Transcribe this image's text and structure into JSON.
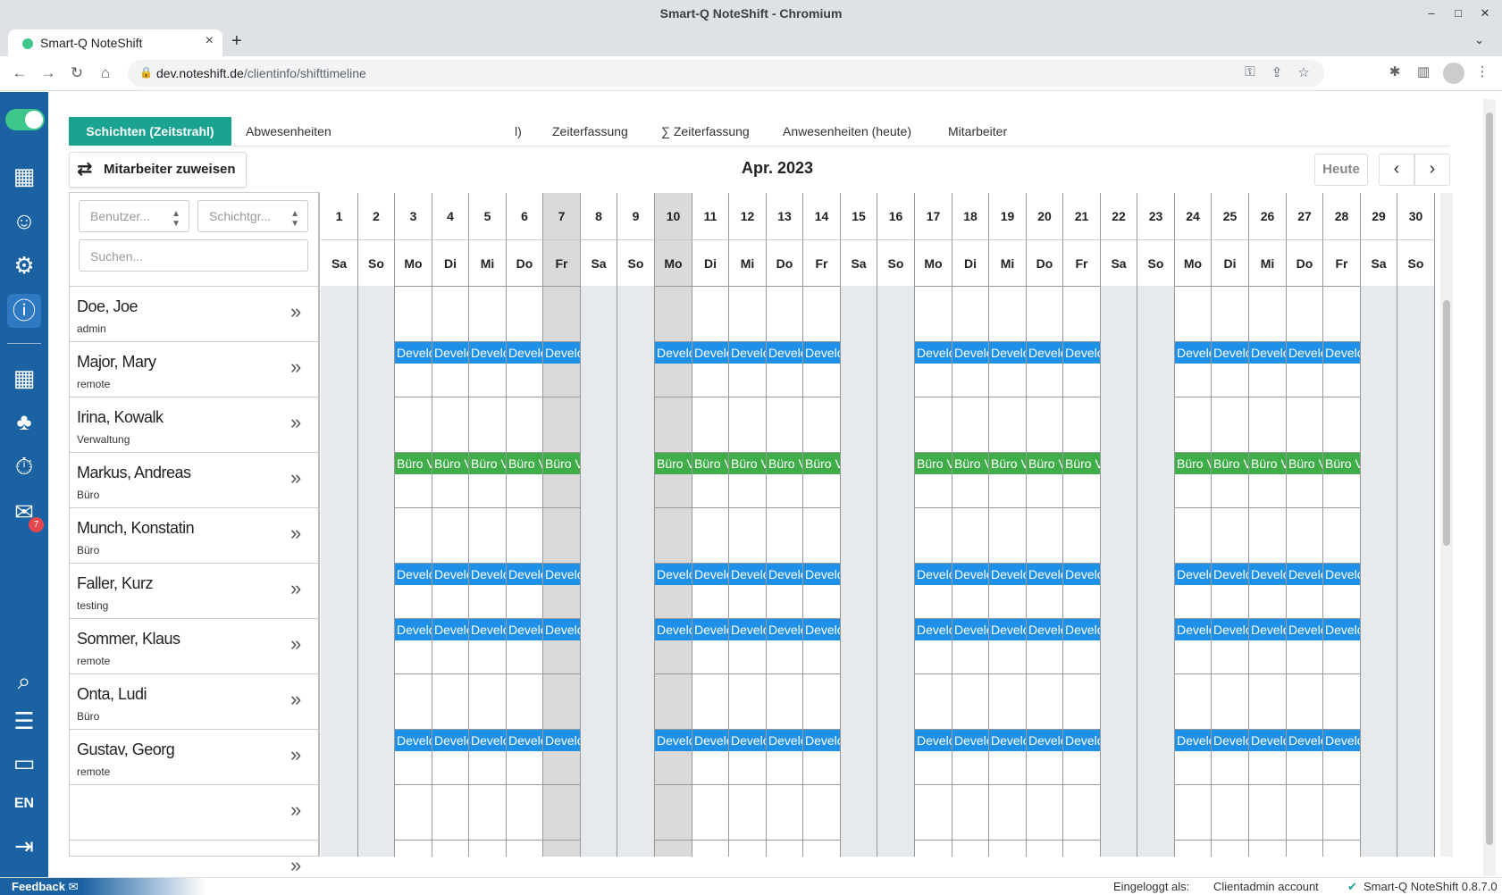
{
  "window": {
    "title": "Smart-Q NoteShift - Chromium"
  },
  "browser": {
    "tab_title": "Smart-Q NoteShift",
    "url_host": "dev.noteshift.de",
    "url_path": "/clientinfo/shifttimeline"
  },
  "tabs": {
    "active": "Schichten (Zeitstrahl)",
    "items": [
      "Abwesenheiten",
      "l)",
      "Zeiterfassung",
      "∑ Zeiterfassung",
      "Anwesenheiten (heute)",
      "Mitarbeiter"
    ]
  },
  "toolbar": {
    "assign_label": "Mitarbeiter zuweisen",
    "month_label": "Apr. 2023",
    "today_label": "Heute"
  },
  "filters": {
    "user_placeholder": "Benutzer...",
    "group_placeholder": "Schichtgr...",
    "search_placeholder": "Suchen..."
  },
  "sidebar": {
    "mail_badge": "7"
  },
  "days": [
    "1",
    "2",
    "3",
    "4",
    "5",
    "6",
    "7",
    "8",
    "9",
    "10",
    "11",
    "12",
    "13",
    "14",
    "15",
    "16",
    "17",
    "18",
    "19",
    "20",
    "21",
    "22",
    "23",
    "24",
    "25",
    "26",
    "27",
    "28",
    "29",
    "30"
  ],
  "weekdays": [
    "Sa",
    "So",
    "Mo",
    "Di",
    "Mi",
    "Do",
    "Fr",
    "Sa",
    "So",
    "Mo",
    "Di",
    "Mi",
    "Do",
    "Fr",
    "Sa",
    "So",
    "Mo",
    "Di",
    "Mi",
    "Do",
    "Fr",
    "Sa",
    "So",
    "Mo",
    "Di",
    "Mi",
    "Do",
    "Fr",
    "Sa",
    "So"
  ],
  "weekend_days": [
    1,
    2,
    8,
    9,
    15,
    16,
    22,
    23,
    29,
    30
  ],
  "highlighted_days": [
    7,
    10
  ],
  "employees": [
    {
      "name": "Doe, Joe",
      "role": "admin",
      "shift": null
    },
    {
      "name": "Major, Mary",
      "role": "remote",
      "shift": {
        "label": "Develo",
        "kind": "dev"
      }
    },
    {
      "name": "Irina, Kowalk",
      "role": "Verwaltung",
      "shift": null
    },
    {
      "name": "Markus, Andreas",
      "role": "Büro",
      "shift": {
        "label": "Büro V",
        "kind": "buero"
      }
    },
    {
      "name": "Munch, Konstatin",
      "role": "Büro",
      "shift": null
    },
    {
      "name": "Faller, Kurz",
      "role": "testing",
      "shift": {
        "label": "Develo",
        "kind": "dev"
      }
    },
    {
      "name": "Sommer, Klaus",
      "role": "remote",
      "shift": {
        "label": "Develo",
        "kind": "dev"
      }
    },
    {
      "name": "Onta, Ludi",
      "role": "Büro",
      "shift": null
    },
    {
      "name": "Gustav, Georg",
      "role": "remote",
      "shift": {
        "label": "Develo",
        "kind": "dev"
      }
    },
    {
      "name": "",
      "role": "",
      "shift": null
    },
    {
      "name": "",
      "role": "",
      "shift": null
    }
  ],
  "shift_days": [
    3,
    4,
    5,
    6,
    7,
    10,
    11,
    12,
    13,
    14,
    17,
    18,
    19,
    20,
    21,
    24,
    25,
    26,
    27,
    28
  ],
  "footer": {
    "feedback": "Feedback",
    "logged_in_label": "Eingeloggt als:",
    "account": "Clientadmin account",
    "version": "Smart-Q NoteShift 0.8.7.0"
  },
  "colors": {
    "sidebar": "#1b62a3",
    "accent": "#1aa391",
    "dev_shift": "#1e90e8",
    "buero_shift": "#3fae49"
  }
}
